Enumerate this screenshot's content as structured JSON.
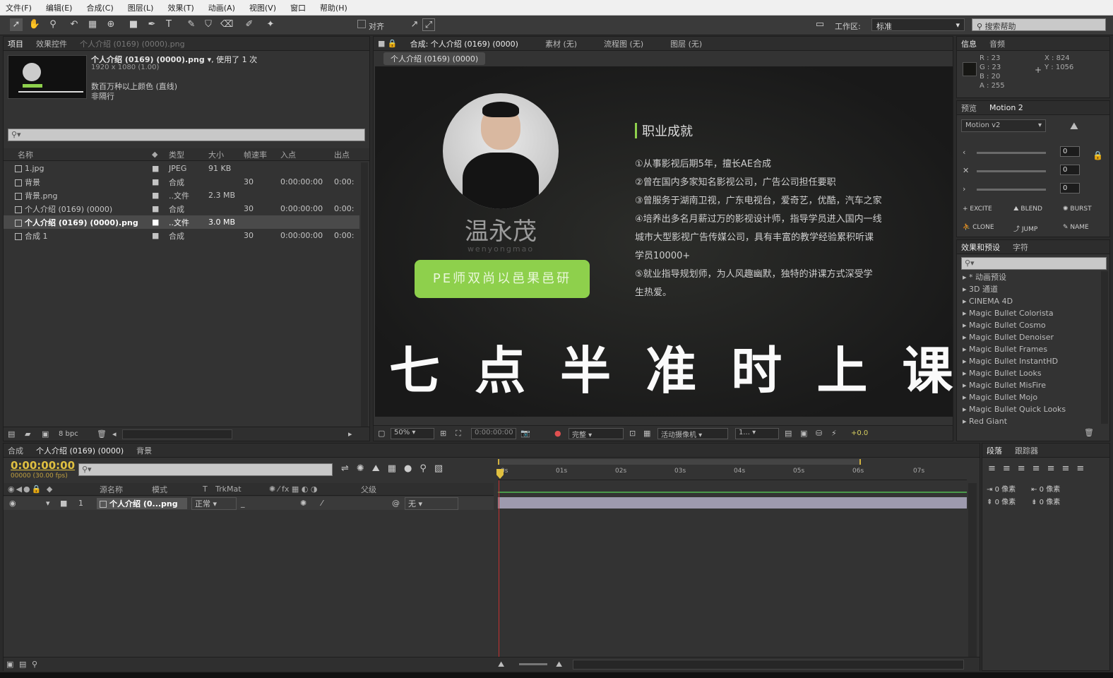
{
  "menu": [
    "文件(F)",
    "编辑(E)",
    "合成(C)",
    "图层(L)",
    "效果(T)",
    "动画(A)",
    "视图(V)",
    "窗口",
    "帮助(H)"
  ],
  "toolbar": {
    "align_label": "对齐",
    "workspace_label": "工作区:",
    "workspace_value": "标准",
    "search_help": "搜索帮助"
  },
  "project": {
    "tabs": [
      "项目",
      "效果控件",
      "个人介绍 (0169) (0000).png"
    ],
    "asset_name": "个人介绍 (0169) (0000).png ▾",
    "used_text": ", 使用了 1 次",
    "asset_dims": "1920 x 1080 (1.00)",
    "asset_color": "数百万种以上颜色 (直线)",
    "asset_interlace": "非隔行",
    "columns": [
      "名称",
      "类型",
      "大小",
      "帧速率",
      "入点",
      "出点"
    ],
    "rows": [
      {
        "name": "1.jpg",
        "type": "JPEG",
        "size": "91 KB",
        "fps": "",
        "in": "",
        "out": ""
      },
      {
        "name": "背景",
        "type": "合成",
        "size": "",
        "fps": "30",
        "in": "0:00:00:00",
        "out": "0:00:"
      },
      {
        "name": "背景.png",
        "type": "..文件",
        "size": "2.3 MB",
        "fps": "",
        "in": "",
        "out": ""
      },
      {
        "name": "个人介绍 (0169) (0000)",
        "type": "合成",
        "size": "",
        "fps": "30",
        "in": "0:00:00:00",
        "out": "0:00:"
      },
      {
        "name": "个人介绍 (0169) (0000).png",
        "type": "..文件",
        "size": "3.0 MB",
        "fps": "",
        "in": "",
        "out": ""
      },
      {
        "name": "合成 1",
        "type": "合成",
        "size": "",
        "fps": "30",
        "in": "0:00:00:00",
        "out": "0:00:"
      }
    ],
    "bpc": "8 bpc"
  },
  "comp": {
    "tabs": [
      "合成: 个人介绍 (0169) (0000)",
      "素材 (无)",
      "流程图 (无)",
      "图层 (无)"
    ],
    "subtab": "个人介绍 (0169) (0000)",
    "person_name": "温永茂",
    "person_pinyin": "wenyongmao",
    "green_button": "PE师双尚以邑果邑研",
    "heading": "职业成就",
    "achievements": [
      "①从事影视后期5年，擅长AE合成",
      "②曾在国内多家知名影视公司，广告公司担任要职",
      "③曾服务于湖南卫视，广东电视台，爱奇艺，优酷，汽车之家",
      "④培养出多名月薪过万的影视设计师，指导学员进入国内一线",
      "城市大型影视广告传媒公司，具有丰富的教学经验累积听课",
      "学员10000+",
      "⑤就业指导规划师，为人风趣幽默，独特的讲课方式深受学",
      "生热爱。"
    ],
    "big_text": "七 点 半 准 时 上 课",
    "zoom": "50%",
    "timecode": "0:00:00:00",
    "quality": "完整",
    "camera": "活动摄像机",
    "views": "1...",
    "exposure": "+0.0"
  },
  "info": {
    "tabs": [
      "信息",
      "音频"
    ],
    "r": "R : 23",
    "g": "G : 23",
    "b": "B : 20",
    "a": "A : 255",
    "x": "X : 824",
    "y": "Y : 1056"
  },
  "motion": {
    "tabs": [
      "预览",
      "Motion 2"
    ],
    "dropdown": "Motion v2",
    "values": [
      "0",
      "0",
      "0"
    ],
    "buttons": [
      "EXCITE",
      "BLEND",
      "BURST",
      "CLONE",
      "JUMP",
      "NAME"
    ]
  },
  "effects": {
    "tabs": [
      "效果和预设",
      "字符"
    ],
    "items": [
      "* 动画预设",
      "3D 通道",
      "CINEMA 4D",
      "Magic Bullet Colorista",
      "Magic Bullet Cosmo",
      "Magic Bullet Denoiser",
      "Magic Bullet Frames",
      "Magic Bullet InstantHD",
      "Magic Bullet Looks",
      "Magic Bullet MisFire",
      "Magic Bullet Mojo",
      "Magic Bullet Quick Looks",
      "Red Giant"
    ]
  },
  "timeline": {
    "tabs": [
      "合成",
      "个人介绍 (0169) (0000)",
      "背景"
    ],
    "timecode": "0:00:00:00",
    "fps_text": "00000 (30.00 fps)",
    "columns": [
      "源名称",
      "模式",
      "T",
      "TrkMat",
      "父级"
    ],
    "layer": {
      "index": "1",
      "name": "个人介绍 (0...png",
      "mode": "正常",
      "parent": "无"
    },
    "ruler": [
      "0s",
      "01s",
      "02s",
      "03s",
      "04s",
      "05s",
      "06s",
      "07s"
    ]
  },
  "paragraph": {
    "tabs": [
      "段落",
      "跟踪器"
    ],
    "px1": "0 像素",
    "px2": "0 像素",
    "px3": "0 像素",
    "px4": "0 像素"
  }
}
